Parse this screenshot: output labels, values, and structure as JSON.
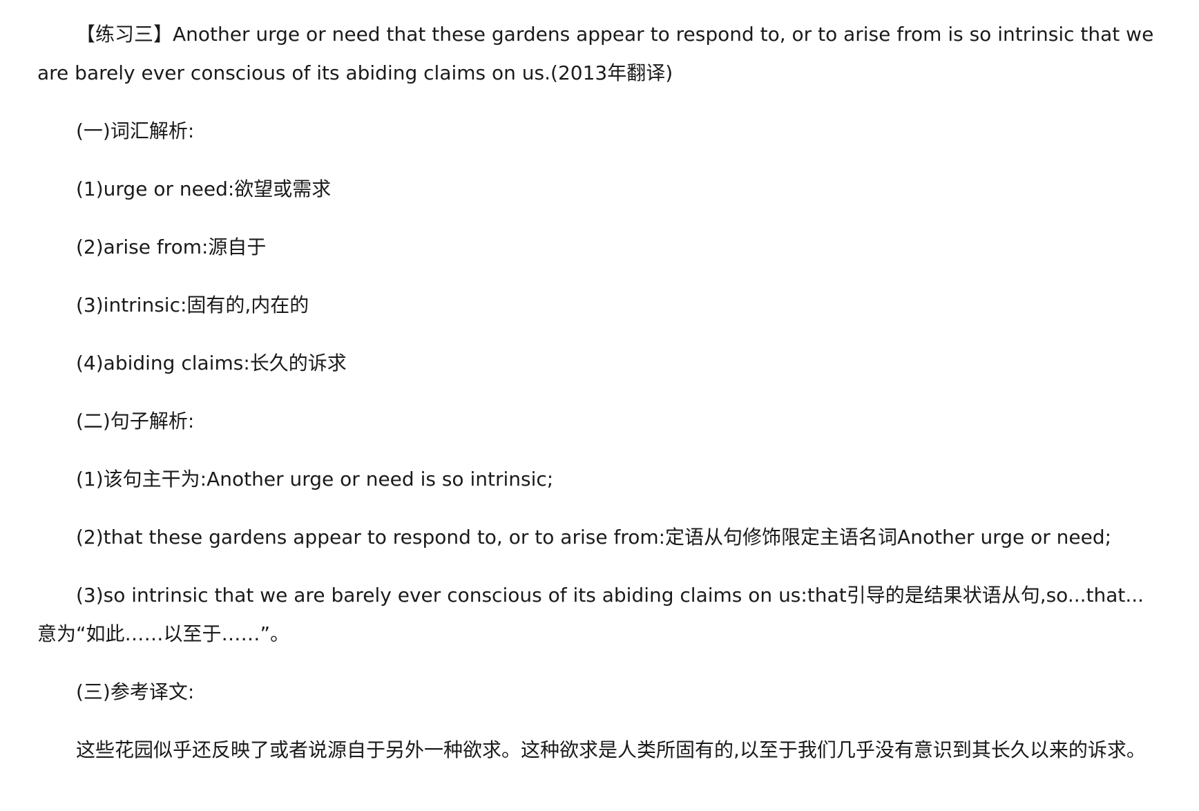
{
  "exercise": {
    "text": "【练习三】Another urge or need that these gardens appear to respond to, or to arise from is so intrinsic that we are barely ever conscious of its abiding claims on us.(2013年翻译)"
  },
  "sections": {
    "vocab_heading": "(一)词汇解析:",
    "vocab_items": [
      "(1)urge or need:欲望或需求",
      "(2)arise from:源自于",
      "(3)intrinsic:固有的,内在的",
      "(4)abiding claims:长久的诉求"
    ],
    "sentence_heading": "(二)句子解析:",
    "sentence_items": [
      "(1)该句主干为:Another urge or need is so intrinsic;",
      "(2)that these gardens appear to respond to, or to arise from:定语从句修饰限定主语名词Another urge or need;",
      "(3)so intrinsic that we are barely ever conscious of its abiding claims on us:that引导的是结果状语从句,so...that...意为“如此……以至于……”。"
    ],
    "translation_heading": "(三)参考译文:",
    "translation_text": "这些花园似乎还反映了或者说源自于另外一种欲求。这种欲求是人类所固有的,以至于我们几乎没有意识到其长久以来的诉求。"
  }
}
